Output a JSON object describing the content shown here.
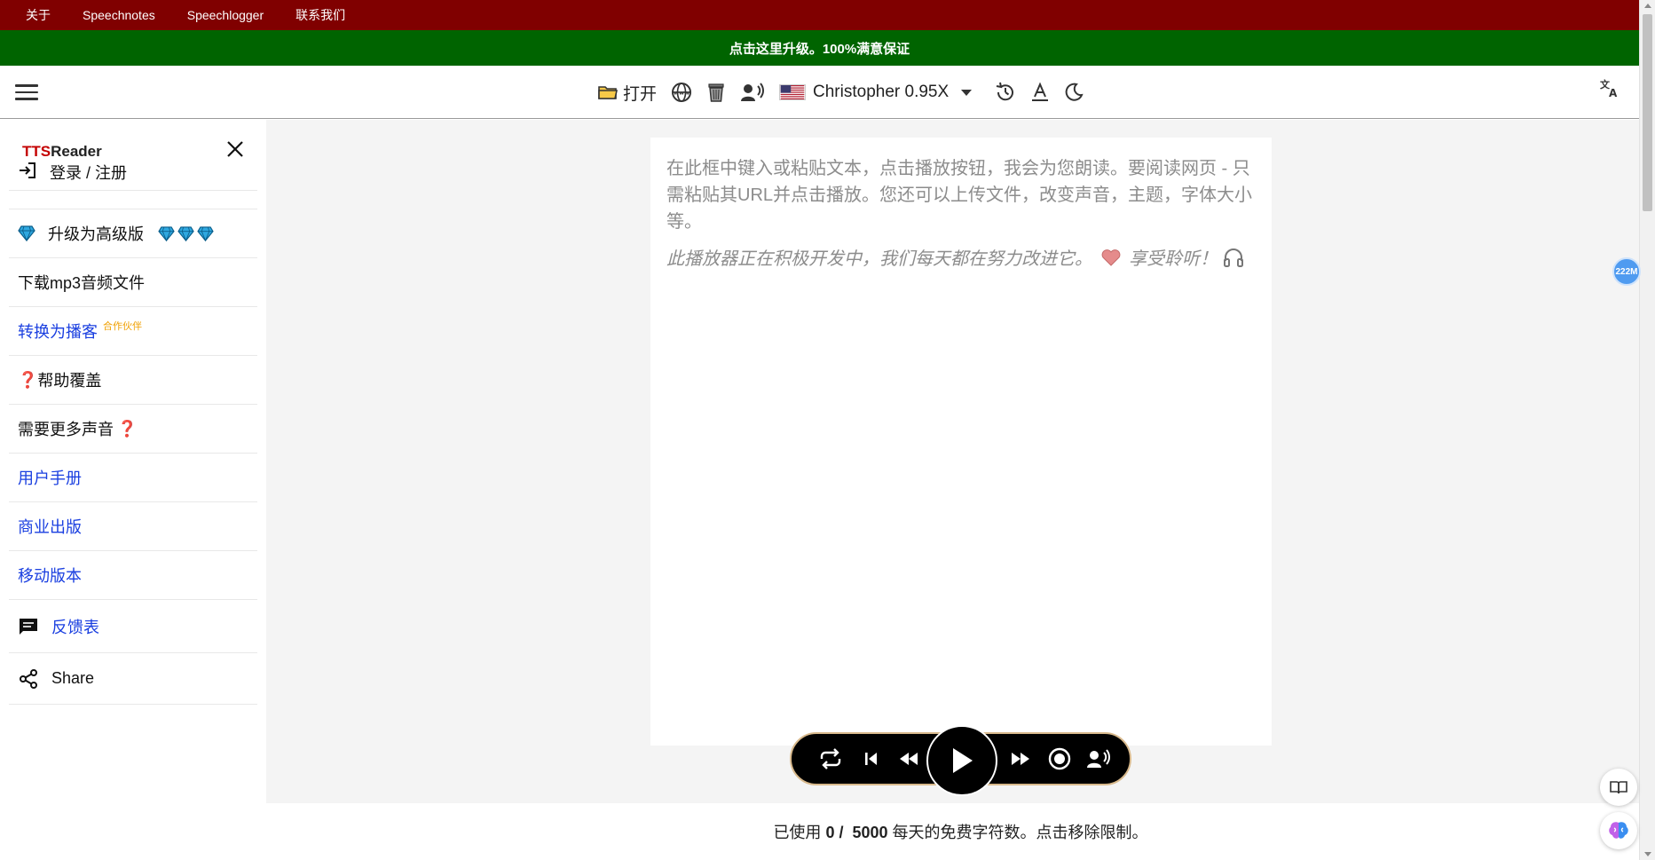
{
  "top_nav": {
    "items": [
      "关于",
      "Speechnotes",
      "Speechlogger",
      "联系我们"
    ]
  },
  "promo": {
    "text": "点击这里升级。100%满意保证"
  },
  "toolbar": {
    "open_label": "打开",
    "voice_label": "Christopher 0.95X",
    "icons": [
      "folder-icon",
      "web-icon",
      "trash-icon",
      "speaker-icon",
      "us-flag-icon",
      "history-icon",
      "font-icon",
      "dark-mode-icon",
      "translate-icon"
    ]
  },
  "sidebar": {
    "brand_red": "TTS",
    "brand_black": "Reader",
    "items": [
      {
        "label": "登录 / 注册",
        "icon": "login-icon"
      },
      {
        "label": "升级为高级版",
        "icon": "diamond-icon"
      },
      {
        "label": "下载mp3音频文件"
      },
      {
        "label": "转换为播客",
        "badge": "合作伙伴"
      },
      {
        "label": "帮助覆盖",
        "prefix": "❓"
      },
      {
        "label": "需要更多声音",
        "suffix": "❓"
      },
      {
        "label": "用户手册"
      },
      {
        "label": "商业出版"
      },
      {
        "label": "移动版本"
      },
      {
        "label": "反馈表",
        "icon": "feedback-icon"
      },
      {
        "label": "Share",
        "icon": "share-icon"
      }
    ]
  },
  "editor": {
    "placeholder_line1": "在此框中键入或粘贴文本，点击播放按钮，我会为您朗读。要阅读网页 - 只需粘贴其URL并点击播放。您还可以上传文件，改变声音，主题，字体大小等。",
    "placeholder_line2a": "此播放器正在积极开发中，我们每天都在努力改进它。",
    "placeholder_line2b": "享受聆听！"
  },
  "usage": {
    "prefix": "已使用",
    "used": "0 /",
    "limit": "5000",
    "suffix": "每天的免费字符数。点击移除限制。"
  },
  "badge": {
    "text": "222M"
  },
  "colors": {
    "top_nav": "#800000",
    "promo": "#006400",
    "link": "#1a3fe0",
    "partner": "#f0a000"
  }
}
